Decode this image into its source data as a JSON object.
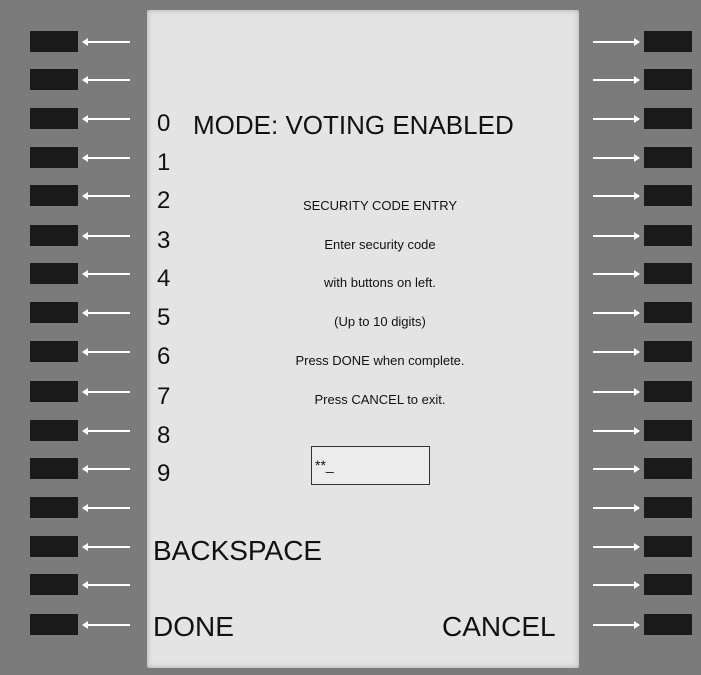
{
  "mode": {
    "label": "MODE: VOTING ENABLED"
  },
  "digits": [
    "0",
    "1",
    "2",
    "3",
    "4",
    "5",
    "6",
    "7",
    "8",
    "9"
  ],
  "messages": [
    "SECURITY CODE ENTRY",
    "Enter security code",
    "with buttons on left.",
    "(Up to 10 digits)",
    "Press DONE when complete.",
    "Press CANCEL to exit."
  ],
  "code_entry": {
    "value": "**_"
  },
  "actions": {
    "backspace": "BACKSPACE",
    "done": "DONE",
    "cancel": "CANCEL"
  },
  "colors": {
    "frame": "#7b7b7b",
    "screen": "#e4e4e4",
    "button": "#1a1a1a",
    "arrow": "#ffffff"
  }
}
